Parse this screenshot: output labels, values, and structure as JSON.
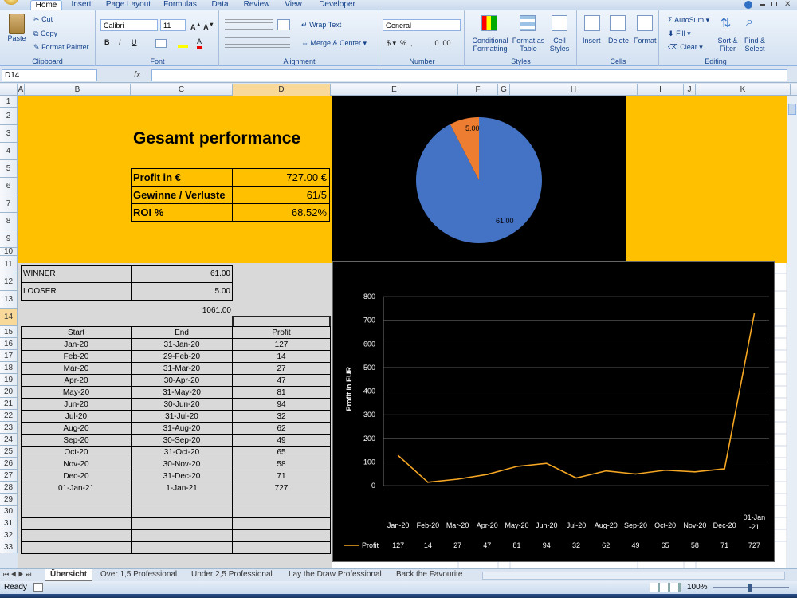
{
  "ribbon": {
    "tabs": [
      "Home",
      "Insert",
      "Page Layout",
      "Formulas",
      "Data",
      "Review",
      "View",
      "Developer"
    ],
    "clipboard": {
      "paste": "Paste",
      "cut": "Cut",
      "copy": "Copy",
      "format_painter": "Format Painter",
      "label": "Clipboard"
    },
    "font": {
      "name": "Calibri",
      "size": "11",
      "label": "Font"
    },
    "alignment": {
      "wrap": "Wrap Text",
      "merge": "Merge & Center",
      "label": "Alignment"
    },
    "number": {
      "format": "General",
      "label": "Number"
    },
    "styles": {
      "conditional": "Conditional Formatting",
      "format_table": "Format as Table",
      "cell_styles": "Cell Styles",
      "label": "Styles"
    },
    "cells": {
      "insert": "Insert",
      "delete": "Delete",
      "format": "Format",
      "label": "Cells"
    },
    "editing": {
      "autosum": "AutoSum",
      "fill": "Fill",
      "clear": "Clear",
      "sort": "Sort & Filter",
      "find": "Find & Select",
      "label": "Editing"
    }
  },
  "formula_bar": {
    "name_box": "D14",
    "fx": "fx",
    "value": ""
  },
  "columns": [
    "A",
    "B",
    "C",
    "D",
    "E",
    "F",
    "G",
    "H",
    "I",
    "J",
    "K"
  ],
  "rows": [
    "1",
    "2",
    "3",
    "4",
    "5",
    "6",
    "7",
    "8",
    "9",
    "10",
    "11",
    "12",
    "13",
    "14",
    "15",
    "16",
    "17",
    "18",
    "19",
    "20",
    "21",
    "22",
    "23",
    "24",
    "25",
    "26",
    "27",
    "28",
    "29",
    "30",
    "31",
    "32",
    "33"
  ],
  "summary": {
    "title": "Gesamt performance",
    "profit_label": "Profit in €",
    "profit_value": "727.00 €",
    "gv_label": "Gewinne / Verluste",
    "gv_value": "61/5",
    "roi_label": "ROI %",
    "roi_value": "68.52%"
  },
  "wl": {
    "winner_label": "WINNER",
    "winner_value": "61.00",
    "looser_label": "LOOSER",
    "looser_value": "5.00",
    "total": "1061.00"
  },
  "table": {
    "headers": [
      "Start",
      "End",
      "Profit"
    ],
    "rows": [
      [
        "Jan-20",
        "31-Jan-20",
        "127"
      ],
      [
        "Feb-20",
        "29-Feb-20",
        "14"
      ],
      [
        "Mar-20",
        "31-Mar-20",
        "27"
      ],
      [
        "Apr-20",
        "30-Apr-20",
        "47"
      ],
      [
        "May-20",
        "31-May-20",
        "81"
      ],
      [
        "Jun-20",
        "30-Jun-20",
        "94"
      ],
      [
        "Jul-20",
        "31-Jul-20",
        "32"
      ],
      [
        "Aug-20",
        "31-Aug-20",
        "62"
      ],
      [
        "Sep-20",
        "30-Sep-20",
        "49"
      ],
      [
        "Oct-20",
        "31-Oct-20",
        "65"
      ],
      [
        "Nov-20",
        "30-Nov-20",
        "58"
      ],
      [
        "Dec-20",
        "31-Dec-20",
        "71"
      ],
      [
        "01-Jan-21",
        "1-Jan-21",
        "727"
      ]
    ]
  },
  "colors": {
    "orange": "#ffc000",
    "line": "#f5a623",
    "pie_blue": "#4472c4",
    "pie_orange": "#ed7d31"
  },
  "chart_data": [
    {
      "type": "pie",
      "categories": [
        "Winner",
        "Looser"
      ],
      "values": [
        61,
        5
      ],
      "labels": [
        "61.00",
        "5.00"
      ]
    },
    {
      "type": "line",
      "categories": [
        "Jan-20",
        "Feb-20",
        "Mar-20",
        "Apr-20",
        "May-20",
        "Jun-20",
        "Jul-20",
        "Aug-20",
        "Sep-20",
        "Oct-20",
        "Nov-20",
        "Dec-20",
        "01-Jan-21"
      ],
      "series": [
        {
          "name": "Profit",
          "values": [
            127,
            14,
            27,
            47,
            81,
            94,
            32,
            62,
            49,
            65,
            58,
            71,
            727
          ]
        }
      ],
      "ylabel": "Profit in EUR",
      "ylim": [
        0,
        800
      ],
      "yticks": [
        "0",
        "100",
        "200",
        "300",
        "400",
        "500",
        "600",
        "700",
        "800"
      ],
      "grid": true,
      "legend": "bottom"
    }
  ],
  "sheet_tabs": [
    "Übersicht",
    "Over 1,5 Professional",
    "Under 2,5 Professional",
    "Lay the Draw Professional",
    "Back the Favourite"
  ],
  "status": {
    "ready": "Ready",
    "zoom": "100%"
  }
}
